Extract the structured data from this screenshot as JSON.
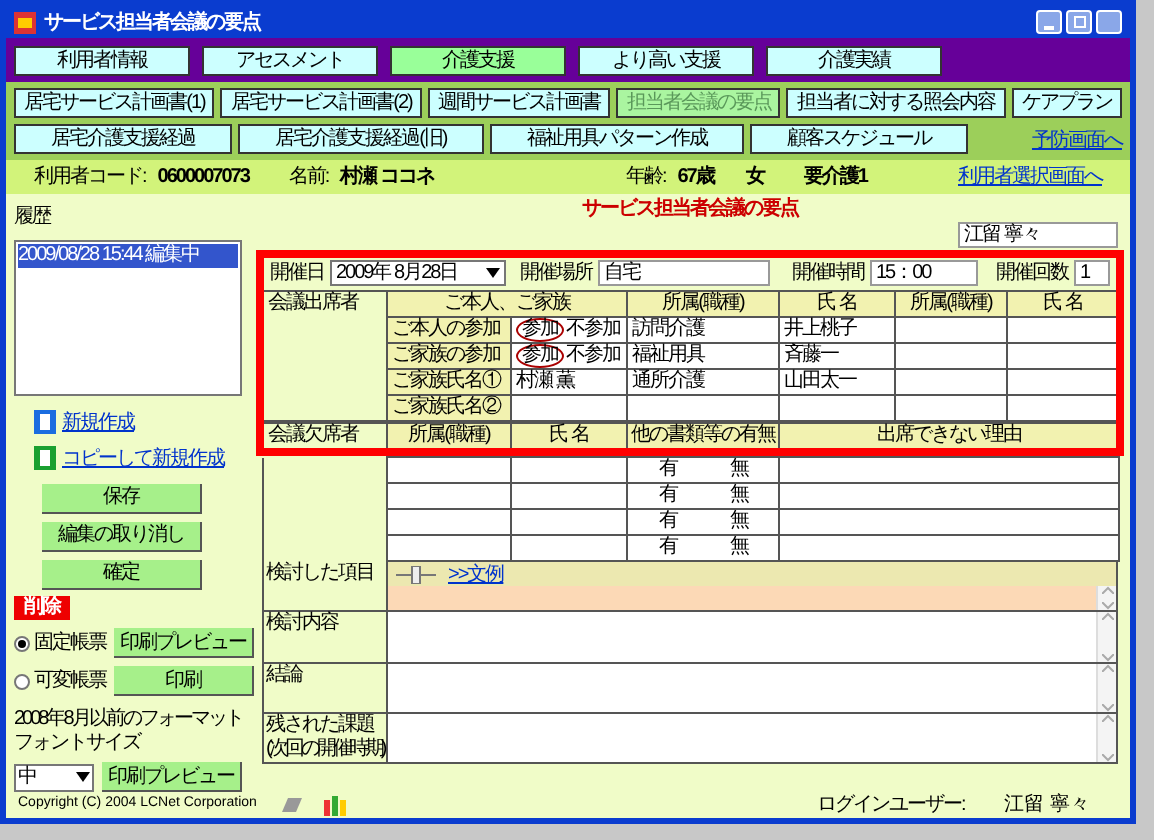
{
  "window": {
    "title": "サービス担当者会議の要点"
  },
  "nav_tabs": [
    {
      "label": "利用者情報",
      "selected": false
    },
    {
      "label": "アセスメント",
      "selected": false
    },
    {
      "label": "介護支援",
      "selected": true
    },
    {
      "label": "より高い支援",
      "selected": false
    },
    {
      "label": "介護実績",
      "selected": false
    }
  ],
  "sub_tab_rows": [
    [
      {
        "label": "居宅サービス計画書(1)",
        "selected": false
      },
      {
        "label": "居宅サービス計画書(2)",
        "selected": false
      },
      {
        "label": "週間サービス計画書",
        "selected": false
      },
      {
        "label": "担当者会議の要点",
        "selected": true
      },
      {
        "label": "担当者に対する照会内容",
        "selected": false
      },
      {
        "label": "ケアプラン",
        "selected": false
      }
    ],
    [
      {
        "label": "居宅介護支援経過",
        "selected": false
      },
      {
        "label": "居宅介護支援経過(旧)",
        "selected": false
      },
      {
        "label": "福祉用具パターン作成",
        "selected": false
      },
      {
        "label": "顧客スケジュール",
        "selected": false
      }
    ]
  ],
  "prevention_link": "予防画面へ",
  "user_info": {
    "code_label": "利用者コード:",
    "code": "0600007073",
    "name_label": "名前:",
    "name": "村瀬 ココネ",
    "age_label": "年齢:",
    "age": "67歳",
    "sex": "女",
    "care_level": "要介護1",
    "select_link": "利用者選択画面へ"
  },
  "history": {
    "title": "履歴",
    "items": [
      {
        "text": "2009/08/28 15:44 編集中",
        "selected": true
      }
    ]
  },
  "actions": {
    "new_link": "新規作成",
    "copy_link": "コピーして新規作成",
    "buttons": [
      "保存",
      "編集の取り消し",
      "確定"
    ],
    "delete": "削除"
  },
  "print": {
    "formats": [
      {
        "label": "固定帳票",
        "selected": true
      },
      {
        "label": "可変帳票",
        "selected": false
      }
    ],
    "preview": "印刷プレビュー",
    "print": "印刷",
    "old_format_note": "2008年8月以前のフォーマット",
    "font_size_label": "フォントサイズ",
    "font_size": "中",
    "old_preview": "印刷プレビュー"
  },
  "form": {
    "title": "サービス担当者会議の要点",
    "reporter": "江留 寧々",
    "date_label": "開催日",
    "date": "2009年 8月28日",
    "place_label": "開催場所",
    "place": "自宅",
    "time_label": "開催時間",
    "time": "15：00",
    "count_label": "開催回数",
    "count": "1"
  },
  "attendees": {
    "label": "会議出席者",
    "family_header": "ご本人、ご家族",
    "columns": [
      "所属(職種)",
      "氏 名",
      "所属(職種)",
      "氏 名"
    ],
    "family_rows": [
      {
        "label": "ご本人の参加",
        "kind": "choice",
        "yes": "参加",
        "no": "不参加",
        "attending": true
      },
      {
        "label": "ご家族の参加",
        "kind": "choice",
        "yes": "参加",
        "no": "不参加",
        "attending": true
      },
      {
        "label": "ご家族氏名①",
        "kind": "name",
        "value": "村瀬 薫"
      },
      {
        "label": "ご家族氏名②",
        "kind": "name"
      }
    ],
    "staff_rows": [
      {
        "affiliation": "訪問介護",
        "name": "井上桃子"
      },
      {
        "affiliation": "福祉用具",
        "name": "斉藤一"
      },
      {
        "affiliation": "通所介護",
        "name": "山田太一"
      }
    ]
  },
  "absentees": {
    "label": "会議欠席者",
    "columns": [
      "所属(職種)",
      "氏 名",
      "他の書類等の有無",
      "出席できない理由"
    ],
    "rows": [
      {
        "yes": "有",
        "no": "無"
      },
      {
        "yes": "有",
        "no": "無"
      },
      {
        "yes": "有",
        "no": "無"
      },
      {
        "yes": "有",
        "no": "無"
      }
    ]
  },
  "sections": [
    {
      "label": "検討した項目",
      "kind": "examples",
      "link": ">>文例"
    },
    {
      "label": "検討内容",
      "kind": "text"
    },
    {
      "label": "結論",
      "kind": "text"
    },
    {
      "label": "残された課題",
      "sublabel": "(次回の開催時期)",
      "kind": "text"
    }
  ],
  "footer": {
    "copyright": "Copyright (C) 2004 LCNet Corporation",
    "login_label": "ログインユーザー:",
    "login_user": "江留 寧々"
  }
}
